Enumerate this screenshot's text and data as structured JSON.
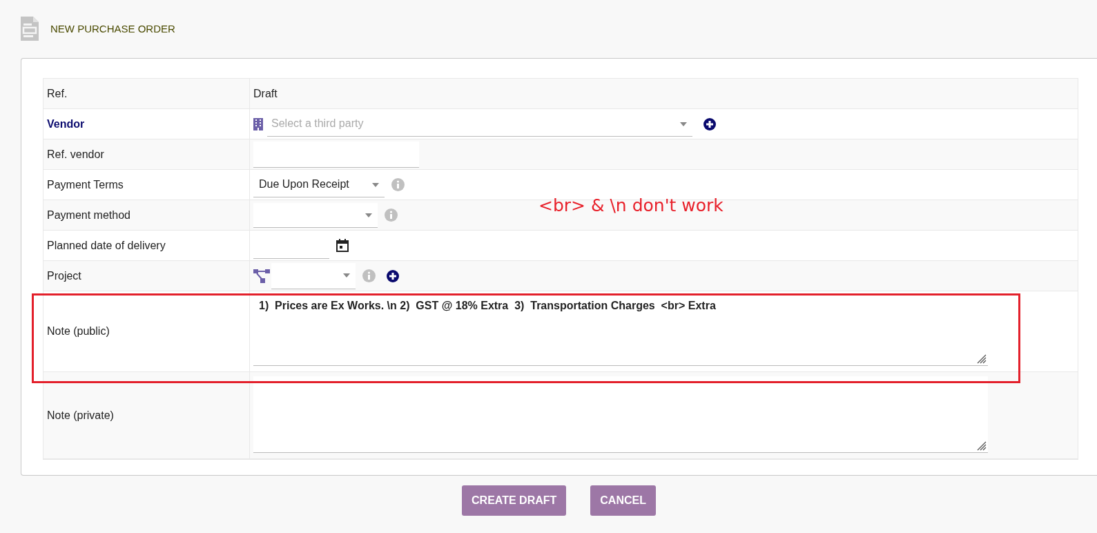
{
  "page": {
    "title": "NEW PURCHASE ORDER"
  },
  "fields": [
    {
      "kind": "text",
      "label": "Ref.",
      "value": "Draft",
      "required": false
    },
    {
      "kind": "thirdparty",
      "label": "Vendor",
      "placeholder": "Select a third party",
      "required": true
    },
    {
      "kind": "input",
      "label": "Ref. vendor",
      "required": false
    },
    {
      "kind": "select",
      "label": "Payment Terms",
      "value": "Due Upon Receipt",
      "required": false
    },
    {
      "kind": "select",
      "label": "Payment method",
      "required": false
    },
    {
      "kind": "date",
      "label": "Planned date of delivery",
      "required": false
    },
    {
      "kind": "project",
      "label": "Project",
      "required": false
    },
    {
      "kind": "note",
      "label": "Note (public)",
      "value": "1)  Prices are Ex Works. \\n 2)  GST @ 18% Extra  3)  Transportation Charges  <br> Extra",
      "highlighted": true,
      "required": false
    },
    {
      "kind": "note",
      "label": "Note (private)",
      "highlighted": false,
      "required": false
    }
  ],
  "annotation": "<br> & \\n don't work",
  "buttons": [
    "CREATE DRAFT",
    "CANCEL"
  ]
}
